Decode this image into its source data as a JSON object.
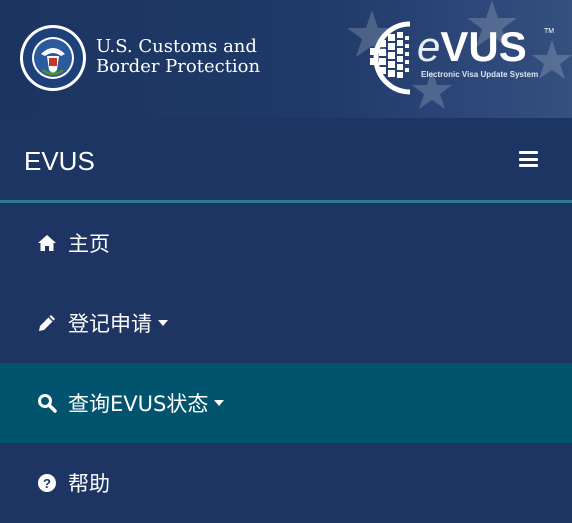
{
  "header": {
    "agency_line1": "U.S. Customs and",
    "agency_line2": "Border Protection",
    "product_word": "VUS",
    "product_e": "e",
    "product_tm": "TM",
    "product_tagline": "Electronic Visa Update System"
  },
  "titlebar": {
    "brand": "EVUS",
    "menu_icon": "hamburger-icon"
  },
  "menu": {
    "items": [
      {
        "label": "主页",
        "icon": "home-icon",
        "dropdown": false
      },
      {
        "label": "登记申请",
        "icon": "pencil-icon",
        "dropdown": true
      },
      {
        "label": "查询EVUS状态",
        "icon": "search-icon",
        "dropdown": true,
        "active": true
      },
      {
        "label": "帮助",
        "icon": "help-icon",
        "dropdown": false
      }
    ]
  },
  "colors": {
    "background": "#1e3563",
    "active_item": "#02546e",
    "divider": "#2b7b95"
  }
}
